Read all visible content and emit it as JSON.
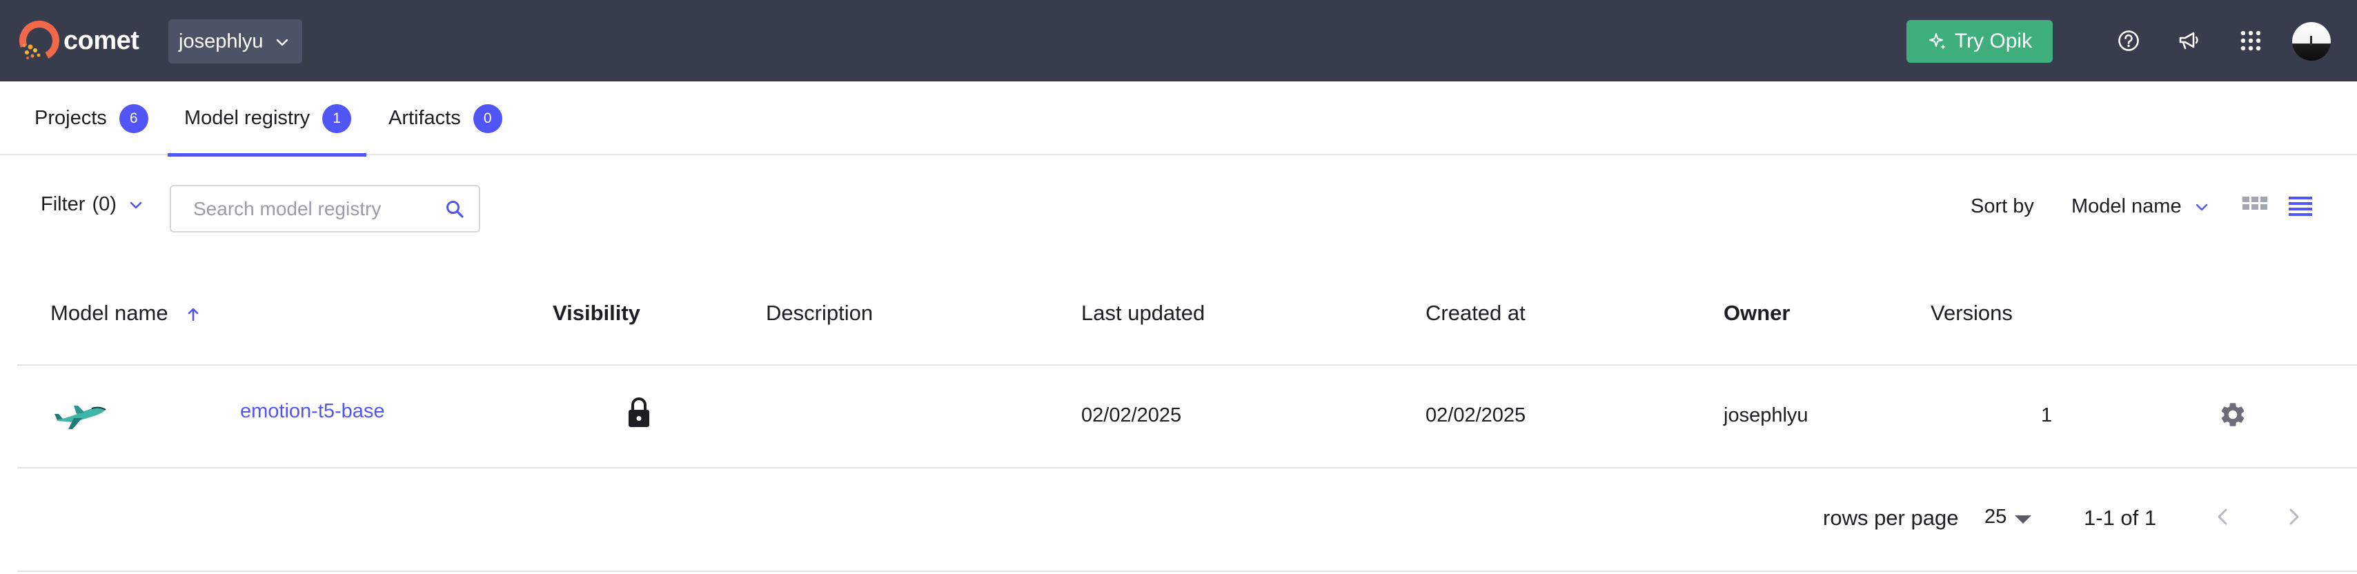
{
  "navbar": {
    "brand": "comet",
    "workspace": "josephlyu",
    "try_opik_label": "Try Opik",
    "icons": [
      "help-icon",
      "announcements-icon",
      "apps-grid-icon"
    ],
    "colors": {
      "bg": "#373d4d",
      "accent_green": "#3fae7d"
    }
  },
  "tabs": [
    {
      "label": "Projects",
      "count": "6"
    },
    {
      "label": "Model registry",
      "count": "1",
      "active": true
    },
    {
      "label": "Artifacts",
      "count": "0"
    }
  ],
  "toolbar": {
    "filter_label": "Filter",
    "filter_count": "(0)",
    "search_placeholder": "Search model registry",
    "sort_by_label": "Sort by",
    "sort_by_value": "Model name",
    "view_modes": [
      "grid-view",
      "list-view"
    ],
    "active_view": "list-view"
  },
  "table": {
    "columns": [
      "Model name",
      "Visibility",
      "Description",
      "Last updated",
      "Created at",
      "Owner",
      "Versions"
    ],
    "sorted_column": "Model name",
    "sort_direction": "ascending",
    "rows": [
      {
        "model_name": "emotion-t5-base",
        "visibility": "private",
        "description": "",
        "last_updated": "02/02/2025",
        "created_at": "02/02/2025",
        "owner": "josephlyu",
        "versions": "1"
      }
    ]
  },
  "pagination": {
    "rows_per_page_label": "rows per page",
    "rows_per_page": "25",
    "range": "1-1 of 1"
  },
  "accent_color": "#5155f5"
}
